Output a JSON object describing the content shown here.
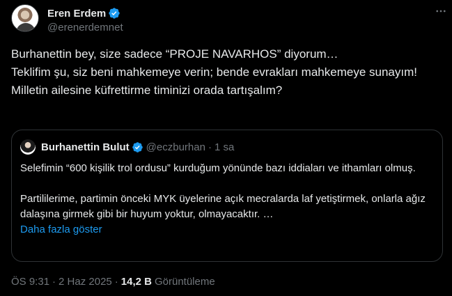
{
  "author": {
    "display_name": "Eren Erdem",
    "handle": "@erenerdemnet"
  },
  "tweet_text": "Burhanettin bey, size sadece “PROJE NAVARHOS” diyorum…\nTeklifim şu, siz beni mahkemeye verin; bende evrakları mahkemeye sunayım!\nMilletin ailesine küfrettirme timinizi orada tartışalım?",
  "quoted": {
    "display_name": "Burhanettin Bulut",
    "handle": "@eczburhan",
    "separator": "·",
    "time": "1 sa",
    "text": "Selefimin “600 kişilik trol ordusu” kurduğum yönünde bazı iddiaları ve ithamları olmuş.\n\nPartililerime, partimin önceki MYK üyelerine açık mecralarda laf yetiştirmek, onlarla ağız dalaşına girmek gibi bir huyum yoktur, olmayacaktır. …",
    "show_more": "Daha fazla göster"
  },
  "meta": {
    "time": "ÖS 9:31",
    "separator": "·",
    "date": "2 Haz 2025",
    "views_count": "14,2 B",
    "views_label": "Görüntüleme"
  },
  "colors": {
    "background": "#000000",
    "text": "#e7e9ea",
    "secondary": "#71767b",
    "link": "#1d9bf0",
    "border": "#2f3336",
    "verified": "#1d9bf0"
  },
  "icons": {
    "verified": "verified-badge-icon",
    "more": "more-horizontal-icon"
  }
}
